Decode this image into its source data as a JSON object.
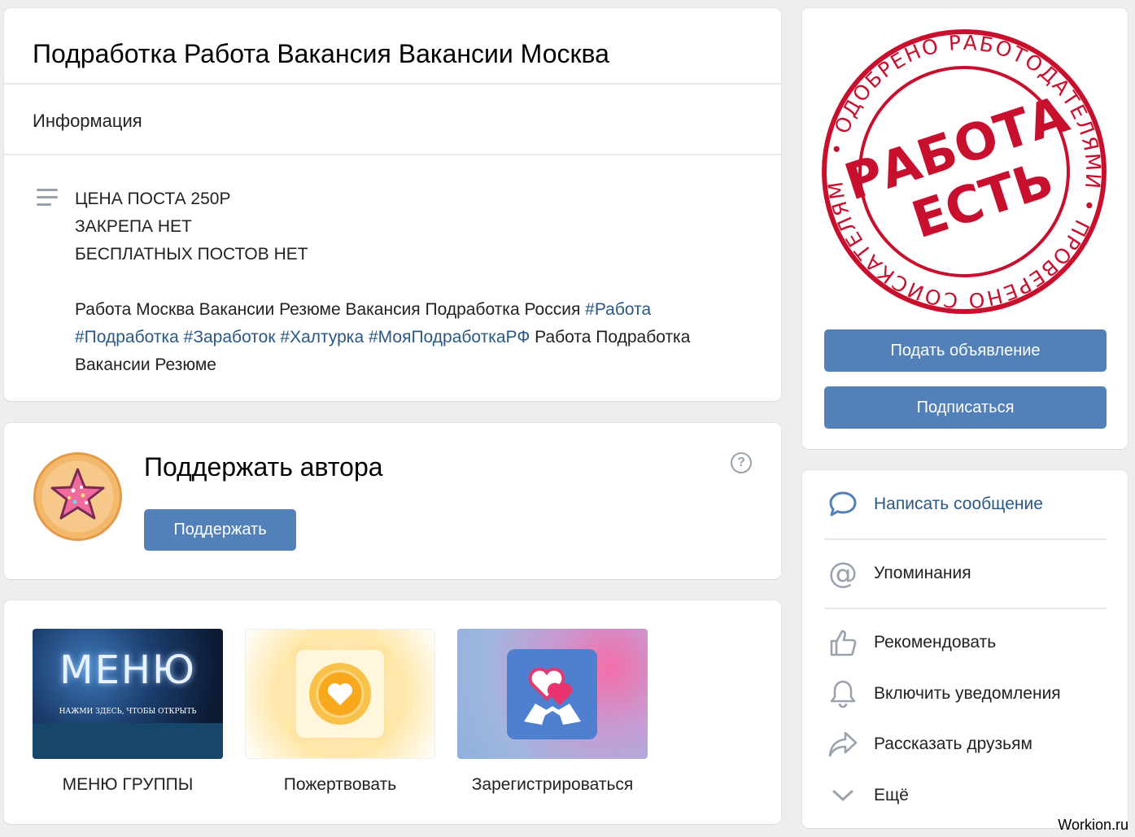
{
  "info": {
    "title": "Подработка Работа Вакансия Вакансии Москва",
    "section_label": "Информация",
    "lines": [
      "ЦЕНА ПОСТА 250Р",
      "ЗАКРЕПА НЕТ",
      "БЕСПЛАТНЫХ ПОСТОВ НЕТ"
    ],
    "para_text_1": "Работа Москва Вакансии Резюме Вакансия Подработка Россия",
    "tag_1": "#Работа",
    "tag_2": "#Подработка",
    "tag_3": "#Заработок",
    "tag_4": "#Халтурка",
    "tag_5": "#МояПодработкаРФ",
    "para_text_2": "Работа Подработка",
    "para_text_3": "Вакансии Резюме"
  },
  "support": {
    "title": "Поддержать автора",
    "button_label": "Поддержать",
    "help_glyph": "?"
  },
  "apps": [
    {
      "label": "МЕНЮ ГРУППЫ",
      "thumb_title": "МЕНЮ",
      "thumb_sub": "НАЖМИ ЗДЕСЬ, ЧТОБЫ ОТКРЫТЬ"
    },
    {
      "label": "Пожертвовать"
    },
    {
      "label": "Зарегистрироваться"
    }
  ],
  "cover": {
    "stamp_main_1": "РАБОТА",
    "stamp_main_2": "ЕСТЬ",
    "stamp_ring_text": "• ОДОБРЕНО РАБОТОДАТЕЛЯМИ • ПРОВЕРЕНО СОИСКАТЕЛЯМИ",
    "submit_label": "Подать объявление",
    "subscribe_label": "Подписаться"
  },
  "actions": [
    {
      "label": "Написать сообщение",
      "icon": "message-icon"
    },
    {
      "label": "Упоминания",
      "icon": "at-icon"
    },
    {
      "label": "Рекомендовать",
      "icon": "thumbs-up-icon"
    },
    {
      "label": "Включить уведомления",
      "icon": "bell-icon"
    },
    {
      "label": "Рассказать друзьям",
      "icon": "share-icon"
    },
    {
      "label": "Ещё",
      "icon": "chevron-down-icon"
    }
  ],
  "watermark": "Workion.ru",
  "colors": {
    "accent": "#5181b8",
    "link": "#2a5885",
    "stamp": "#c8102e"
  }
}
